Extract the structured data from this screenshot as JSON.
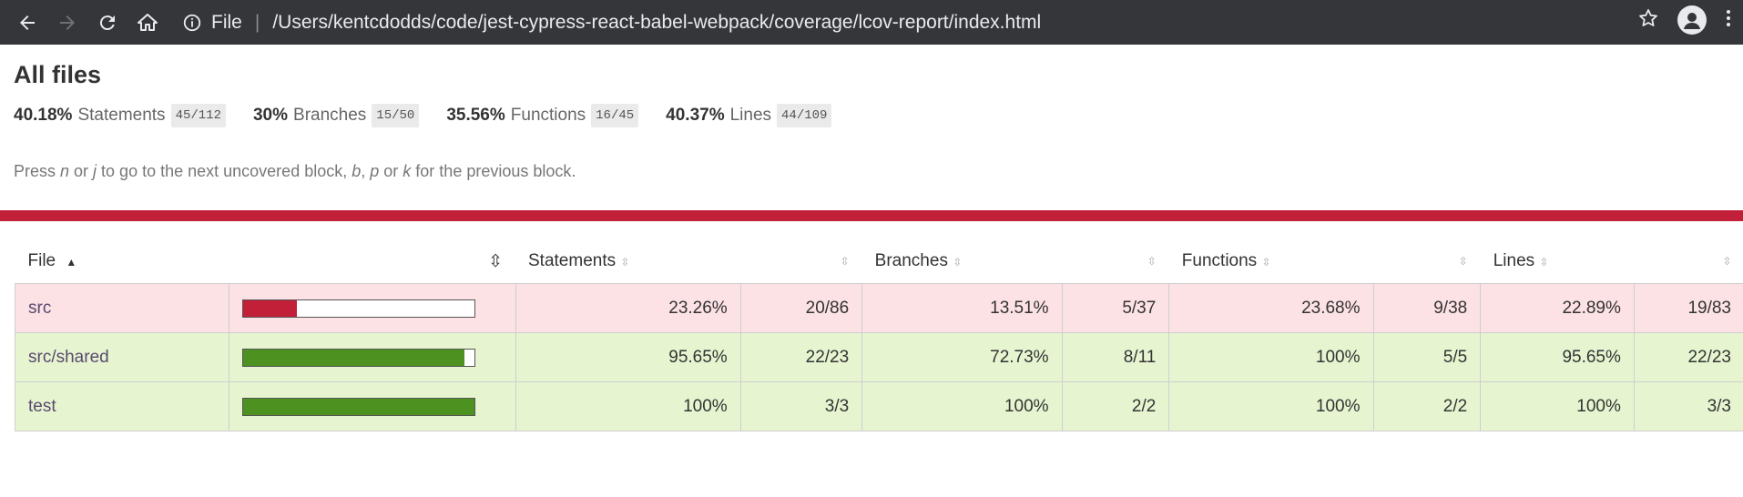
{
  "browser": {
    "scheme": "File",
    "url": "/Users/kentcdodds/code/jest-cypress-react-babel-webpack/coverage/lcov-report/index.html",
    "icons": [
      "back-icon",
      "forward-icon",
      "reload-icon",
      "home-icon",
      "info-icon",
      "star-icon",
      "avatar-icon",
      "menu-icon"
    ]
  },
  "report": {
    "title": "All files",
    "summary": [
      {
        "pct": "40.18%",
        "label": "Statements",
        "frac": "45/112"
      },
      {
        "pct": "30%",
        "label": "Branches",
        "frac": "15/50"
      },
      {
        "pct": "35.56%",
        "label": "Functions",
        "frac": "16/45"
      },
      {
        "pct": "40.37%",
        "label": "Lines",
        "frac": "44/109"
      }
    ],
    "hint": {
      "pre": "Press ",
      "k1": "n",
      "or1": " or ",
      "k2": "j",
      "mid": " to go to the next uncovered block, ",
      "k3": "b",
      "comma": ", ",
      "k4": "p",
      "or2": " or ",
      "k5": "k",
      "post": " for the previous block."
    },
    "colors": {
      "low": "#c21f39",
      "high": "#4d9221",
      "low_bg": "#fce1e5",
      "high_bg": "#e6f5d0"
    }
  },
  "table": {
    "headers": {
      "file": "File",
      "statements": "Statements",
      "branches": "Branches",
      "functions": "Functions",
      "lines": "Lines"
    },
    "rows": [
      {
        "file": "src",
        "coverage_fraction": 0.2326,
        "level": "low",
        "statements": "23.26%",
        "statements_frac": "20/86",
        "branches": "13.51%",
        "branches_frac": "5/37",
        "functions": "23.68%",
        "functions_frac": "9/38",
        "lines": "22.89%",
        "lines_frac": "19/83"
      },
      {
        "file": "src/shared",
        "coverage_fraction": 0.9565,
        "level": "high",
        "statements": "95.65%",
        "statements_frac": "22/23",
        "branches": "72.73%",
        "branches_frac": "8/11",
        "functions": "100%",
        "functions_frac": "5/5",
        "lines": "95.65%",
        "lines_frac": "22/23"
      },
      {
        "file": "test",
        "coverage_fraction": 1.0,
        "level": "high",
        "statements": "100%",
        "statements_frac": "3/3",
        "branches": "100%",
        "branches_frac": "2/2",
        "functions": "100%",
        "functions_frac": "2/2",
        "lines": "100%",
        "lines_frac": "3/3"
      }
    ]
  }
}
